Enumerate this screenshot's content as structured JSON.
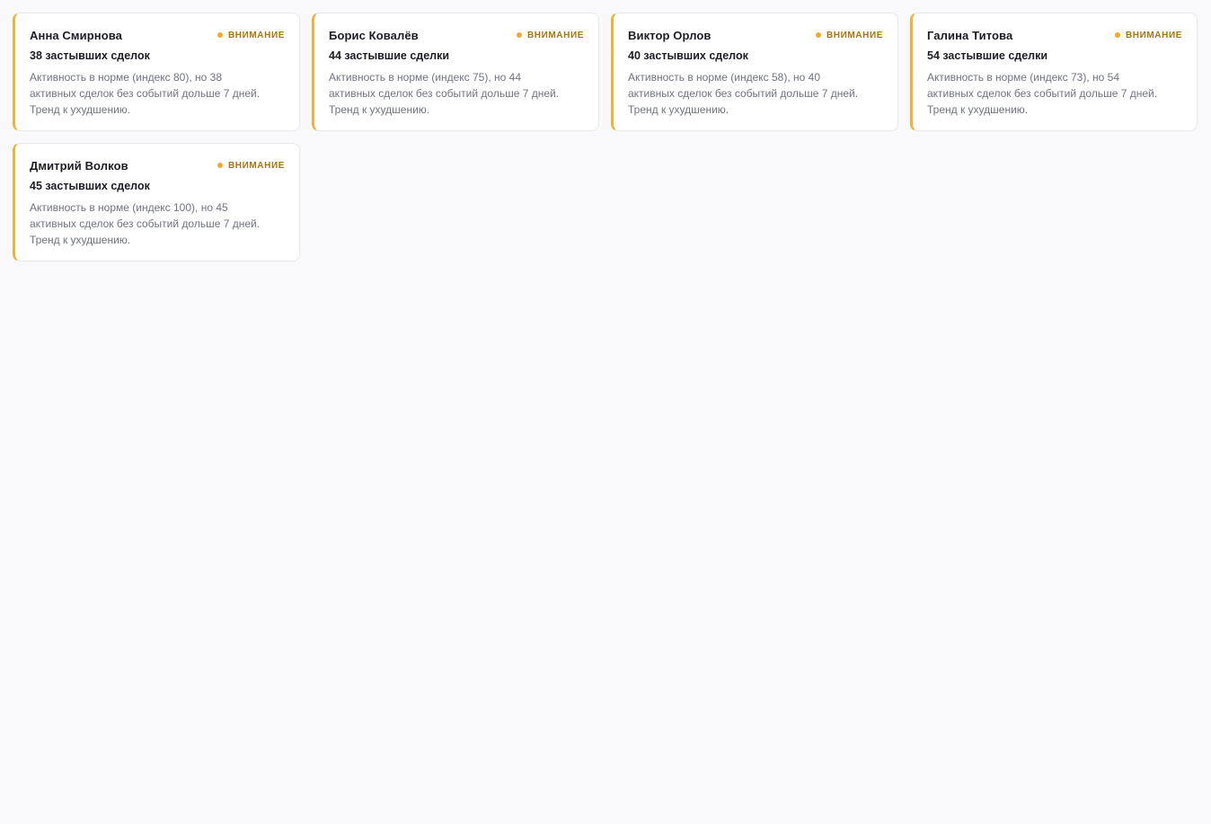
{
  "colors": {
    "accent": "#f0b23a",
    "badge_text": "#a87412",
    "background": "#f9f9fb"
  },
  "cards": [
    {
      "name": "Анна Смирнова",
      "badge": "ВНИМАНИЕ",
      "count": "38 застывших сделок",
      "desc_1": "Активность в норме (индекс 80), но 38",
      "desc_2": "активных сделок без событий дольше 7 дней.",
      "desc_3": "Тренд к ухудшению."
    },
    {
      "name": "Борис Ковалёв",
      "badge": "ВНИМАНИЕ",
      "count": "44 застывшие сделки",
      "desc_1": "Активность в норме (индекс 75), но 44",
      "desc_2": "активных сделок без событий дольше 7 дней.",
      "desc_3": "Тренд к ухудшению."
    },
    {
      "name": "Виктор Орлов",
      "badge": "ВНИМАНИЕ",
      "count": "40 застывших сделок",
      "desc_1": "Активность в норме (индекс 58), но 40",
      "desc_2": "активных сделок без событий дольше 7 дней.",
      "desc_3": "Тренд к ухудшению."
    },
    {
      "name": "Галина Титова",
      "badge": "ВНИМАНИЕ",
      "count": "54 застывшие сделки",
      "desc_1": "Активность в норме (индекс 73), но 54",
      "desc_2": "активных сделок без событий дольше 7 дней.",
      "desc_3": "Тренд к ухудшению."
    },
    {
      "name": "Дмитрий Волков",
      "badge": "ВНИМАНИЕ",
      "count": "45 застывших сделок",
      "desc_1": "Активность в норме (индекс 100), но 45",
      "desc_2": "активных сделок без событий дольше 7 дней.",
      "desc_3": "Тренд к ухудшению."
    }
  ]
}
